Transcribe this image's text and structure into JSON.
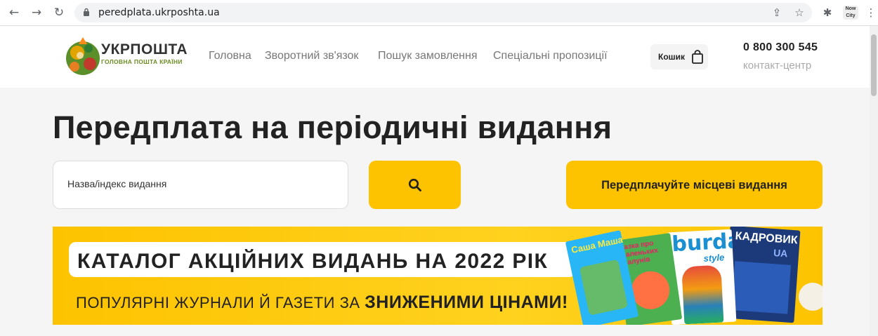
{
  "browser": {
    "url": "peredplata.ukrposhta.ua",
    "extension_badge": "Now City"
  },
  "header": {
    "logo_title": "УКРПОШТА",
    "logo_subtitle": "ГОЛОВНА ПОШТА КРАЇНИ",
    "menu": [
      {
        "label": "Головна"
      },
      {
        "label": "Зворотний зв'язок"
      },
      {
        "label": "Пошук замовлення"
      },
      {
        "label": "Спеціальні пропозиції"
      }
    ],
    "cart_label": "Кошик",
    "phone": "0 800 300 545",
    "phone_caption": "контакт-центр"
  },
  "main": {
    "title": "Передплата на періодичні видання",
    "search_placeholder": "Назва/індекс видання",
    "local_button": "Передплачуйте місцеві видання"
  },
  "banner": {
    "title": "КАТАЛОГ АКЦІЙНИХ ВИДАНЬ НА 2022 РІК",
    "subtitle_plain": "ПОПУЛЯРНІ ЖУРНАЛИ Й ГАЗЕТИ ЗА ",
    "subtitle_bold": "ЗНИЖЕНИМИ ЦІНАМИ!",
    "magazines": [
      "Саша Маша",
      "Казка про маленьких шалунів",
      "burda",
      "style",
      "КАДРОВИК",
      "UA"
    ]
  },
  "colors": {
    "accent": "#fdc300",
    "text_dark": "#222222",
    "menu_text": "#777777"
  }
}
